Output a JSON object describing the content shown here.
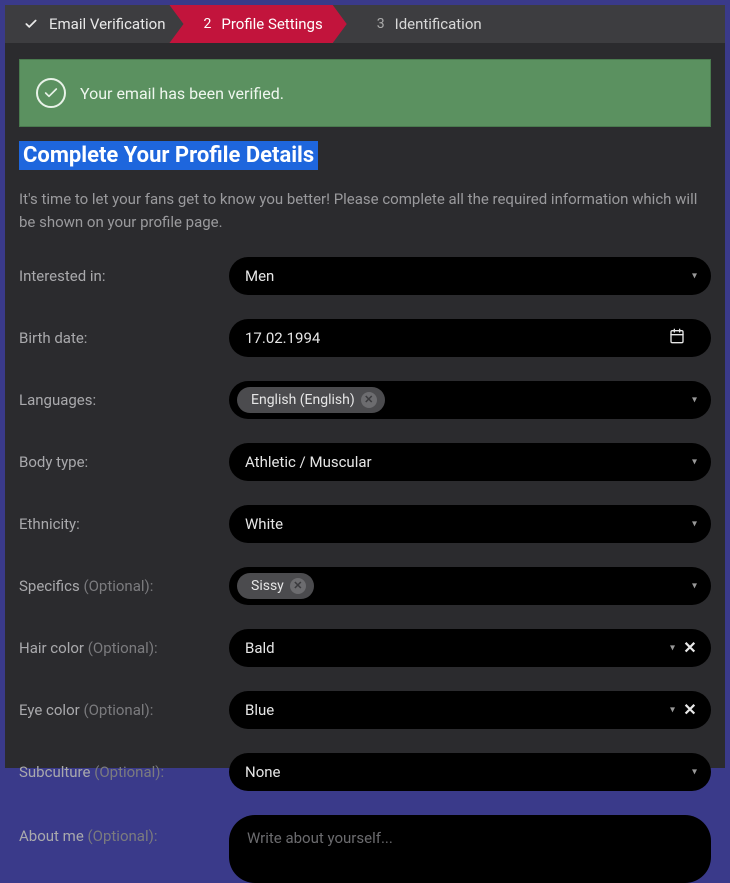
{
  "stepper": {
    "step1": {
      "label": "Email Verification",
      "done": true
    },
    "step2": {
      "num": "2",
      "label": "Profile Settings"
    },
    "step3": {
      "num": "3",
      "label": "Identification"
    }
  },
  "banner": {
    "text": "Your email has been verified."
  },
  "heading": "Complete Your Profile Details",
  "intro": "It's time to let your fans get to know you better! Please complete all the required information which will be shown on your profile page.",
  "fields": {
    "interested_in": {
      "label": "Interested in:",
      "value": "Men"
    },
    "birth_date": {
      "label": "Birth date:",
      "value": "17.02.1994"
    },
    "languages": {
      "label": "Languages:",
      "tags": [
        "English (English)"
      ]
    },
    "body_type": {
      "label": "Body type:",
      "value": "Athletic / Muscular"
    },
    "ethnicity": {
      "label": "Ethnicity:",
      "value": "White"
    },
    "specifics": {
      "label": "Specifics",
      "optional": "(Optional):",
      "tags": [
        "Sissy"
      ]
    },
    "hair_color": {
      "label": "Hair color",
      "optional": "(Optional):",
      "value": "Bald",
      "clearable": true
    },
    "eye_color": {
      "label": "Eye color",
      "optional": "(Optional):",
      "value": "Blue",
      "clearable": true
    },
    "subculture": {
      "label": "Subculture",
      "optional": "(Optional):",
      "value": "None"
    },
    "about_me": {
      "label": "About me",
      "optional": "(Optional):",
      "placeholder": "Write about yourself..."
    }
  }
}
